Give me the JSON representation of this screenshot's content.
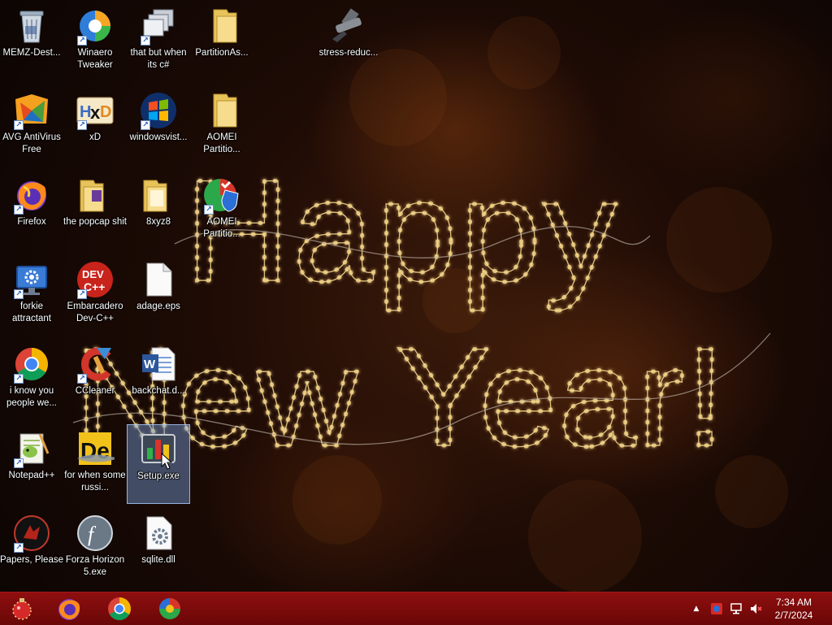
{
  "desktop": {
    "greeting_line1": "Happy",
    "greeting_line2": "New Year!",
    "icons": [
      {
        "label": "MEMZ-Dest...",
        "icon": "recycle-bin-icon"
      },
      {
        "label": "Winaero Tweaker",
        "icon": "winaero-icon"
      },
      {
        "label": "that but when its c#",
        "icon": "windows-stack-icon"
      },
      {
        "label": "PartitionAs...",
        "icon": "folder-icon"
      },
      {
        "label": "stress-reduc...",
        "icon": "stress-tool-icon"
      },
      {
        "label": "AVG AntiVirus Free",
        "icon": "avg-icon"
      },
      {
        "label": "xD",
        "icon": "hxd-icon"
      },
      {
        "label": "windowsvist...",
        "icon": "windows-vista-icon"
      },
      {
        "label": "AOMEI Partitio...",
        "icon": "folder-icon"
      },
      {
        "label": "Firefox",
        "icon": "firefox-icon"
      },
      {
        "label": "the popcap shit",
        "icon": "folder-icon"
      },
      {
        "label": "8xyz8",
        "icon": "folder-icon"
      },
      {
        "label": "AOMEI Partitio...",
        "icon": "aomei-shield-icon"
      },
      {
        "label": "forkie attractant",
        "icon": "monitor-gear-icon"
      },
      {
        "label": "Embarcadero Dev-C++",
        "icon": "devcpp-icon"
      },
      {
        "label": "adage.eps",
        "icon": "blank-file-icon"
      },
      {
        "label": "i know you people we...",
        "icon": "chrome-icon"
      },
      {
        "label": "CCleaner",
        "icon": "ccleaner-icon"
      },
      {
        "label": "backchat.d...",
        "icon": "word-document-icon"
      },
      {
        "label": "Notepad++",
        "icon": "notepadpp-icon"
      },
      {
        "label": "for when some russi...",
        "icon": "de-app-icon"
      },
      {
        "label": "Setup.exe",
        "icon": "setup-installer-icon"
      },
      {
        "label": "Papers, Please",
        "icon": "papers-please-icon"
      },
      {
        "label": "Forza Horizon 5.exe",
        "icon": "flash-player-icon"
      },
      {
        "label": "sqlite.dll",
        "icon": "dll-gear-icon"
      }
    ]
  },
  "taskbar": {
    "pinned": [
      {
        "name": "start-button",
        "icon": "christmas-ornament-icon"
      },
      {
        "name": "taskbar-firefox",
        "icon": "firefox-icon"
      },
      {
        "name": "taskbar-chrome",
        "icon": "chrome-icon"
      },
      {
        "name": "taskbar-app",
        "icon": "colorful-app-icon"
      }
    ],
    "tray": {
      "show_hidden_glyph": "▲",
      "time": "7:34 AM",
      "date": "2/7/2024"
    }
  },
  "colors": {
    "taskbar": "#7d0b0b",
    "background": "#1e0b05",
    "lights": "#f6dc8a"
  }
}
